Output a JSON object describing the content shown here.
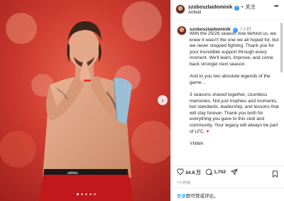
{
  "post": {
    "username": "szoboszlaidominik",
    "verified_badge": "✓",
    "separator": "•",
    "follow_label": "关注",
    "location": "Anfield",
    "more_icon": "more-icon",
    "time_ago": "7小时",
    "caption_paragraphs": [
      "With the 25/26 season now behind us, we knew it wasn't the one we all hoped for, but we never stopped fighting. Thank you for your incredible support through every moment. We'll learn, improve, and come back stronger next season.",
      "And to you two absolute legends of the game...",
      "3 seasons shared together, countless memories. Not just trophies and moments, but standards, leadership, and lessons that will stay forever. Thank you both for everything you gave to this club and community. Your legacy will always be part of LFC.",
      "YNWA"
    ],
    "heart_emoji": "♥",
    "likes_count": "34.8 万",
    "comments_count": "1,702",
    "date": "7小时前",
    "login_prompt": {
      "link": "登录",
      "text": "即可赞或评论。"
    }
  },
  "carousel": {
    "next_arrow": "›",
    "dot_count": 5,
    "active_dot": 0
  },
  "colors": {
    "accent_link": "#0095f6",
    "verified": "#3897f0",
    "heart": "#e0245e",
    "background_red": "#c9352c"
  }
}
